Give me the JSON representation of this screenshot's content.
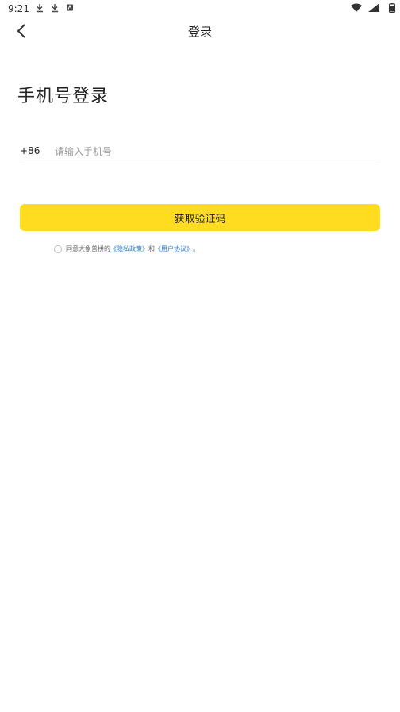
{
  "status_bar": {
    "time": "9:21",
    "icons": [
      "download-icon",
      "download-icon",
      "app-notification-icon"
    ],
    "right_icons": [
      "wifi-icon",
      "signal-icon",
      "battery-icon"
    ]
  },
  "header": {
    "title": "登录",
    "back_icon": "chevron-left-icon"
  },
  "login": {
    "heading": "手机号登录",
    "country_code": "+86",
    "phone_value": "",
    "phone_placeholder": "请输入手机号",
    "submit_label": "获取验证码"
  },
  "agreement": {
    "checked": false,
    "prefix": "同意大象普拼的",
    "privacy_link": "《隐私政策》",
    "connector": "和",
    "terms_link": "《用户协议》",
    "suffix": "。"
  },
  "colors": {
    "accent": "#ffdc1f",
    "link": "#2a7bd6",
    "divider": "#e6e6e6"
  }
}
